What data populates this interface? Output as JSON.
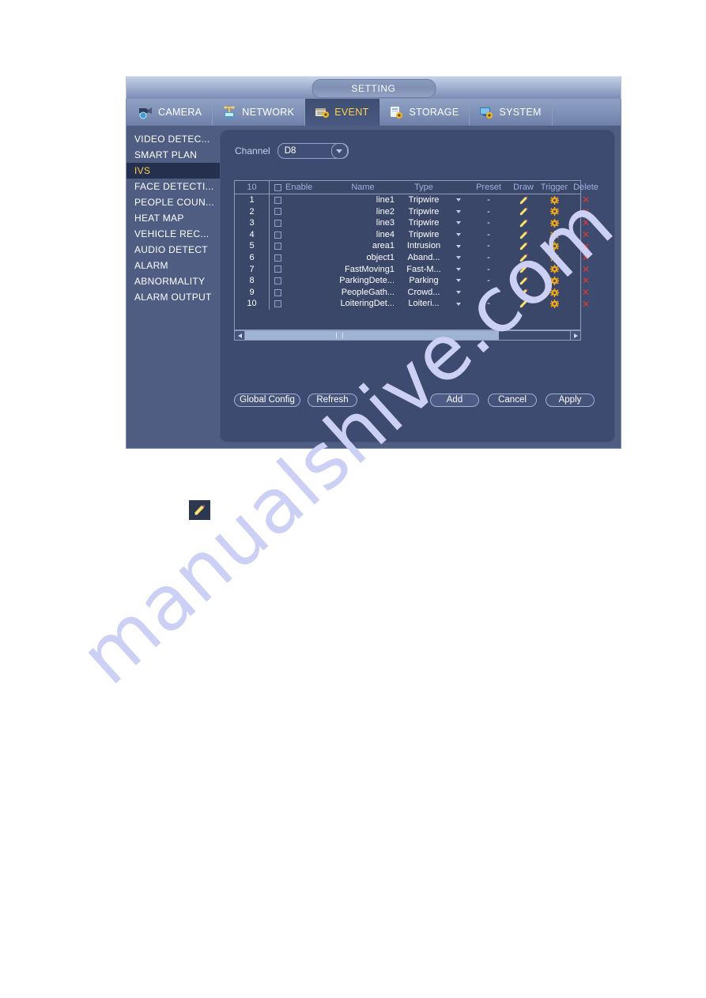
{
  "window": {
    "title": "SETTING",
    "tabs": [
      {
        "label": "CAMERA",
        "icon": "camera-icon",
        "active": false
      },
      {
        "label": "NETWORK",
        "icon": "network-icon",
        "active": false
      },
      {
        "label": "EVENT",
        "icon": "event-icon",
        "active": true
      },
      {
        "label": "STORAGE",
        "icon": "storage-icon",
        "active": false
      },
      {
        "label": "SYSTEM",
        "icon": "system-icon",
        "active": false
      }
    ]
  },
  "sidebar": {
    "items": [
      {
        "label": "VIDEO DETEC...",
        "active": false
      },
      {
        "label": "SMART PLAN",
        "active": false
      },
      {
        "label": "IVS",
        "active": true
      },
      {
        "label": "FACE DETECTI...",
        "active": false
      },
      {
        "label": "PEOPLE COUN...",
        "active": false
      },
      {
        "label": "HEAT MAP",
        "active": false
      },
      {
        "label": "VEHICLE REC...",
        "active": false
      },
      {
        "label": "AUDIO DETECT",
        "active": false
      },
      {
        "label": "ALARM",
        "active": false
      },
      {
        "label": "ABNORMALITY",
        "active": false
      },
      {
        "label": "ALARM OUTPUT",
        "active": false
      }
    ]
  },
  "channel": {
    "label": "Channel",
    "value": "D8",
    "options": [
      "D8"
    ]
  },
  "table": {
    "headers": {
      "count": "10",
      "enable": "Enable",
      "name": "Name",
      "type": "Type",
      "preset": "Preset",
      "draw": "Draw",
      "trigger": "Trigger",
      "delete": "Delete"
    },
    "rows": [
      {
        "index": "1",
        "enabled": false,
        "name": "line1",
        "type": "Tripwire",
        "preset": "-"
      },
      {
        "index": "2",
        "enabled": false,
        "name": "line2",
        "type": "Tripwire",
        "preset": "-"
      },
      {
        "index": "3",
        "enabled": false,
        "name": "line3",
        "type": "Tripwire",
        "preset": "-"
      },
      {
        "index": "4",
        "enabled": false,
        "name": "line4",
        "type": "Tripwire",
        "preset": "-"
      },
      {
        "index": "5",
        "enabled": false,
        "name": "area1",
        "type": "Intrusion",
        "preset": "-"
      },
      {
        "index": "6",
        "enabled": false,
        "name": "object1",
        "type": "Aband...",
        "preset": "-"
      },
      {
        "index": "7",
        "enabled": false,
        "name": "FastMoving1",
        "type": "Fast-M...",
        "preset": "-"
      },
      {
        "index": "8",
        "enabled": false,
        "name": "ParkingDete...",
        "type": "Parking",
        "preset": "-"
      },
      {
        "index": "9",
        "enabled": false,
        "name": "PeopleGath...",
        "type": "Crowd...",
        "preset": "-"
      },
      {
        "index": "10",
        "enabled": false,
        "name": "LoiteringDet...",
        "type": "Loiteri...",
        "preset": "-"
      }
    ]
  },
  "buttons": {
    "global_config": "Global Config",
    "refresh": "Refresh",
    "add": "Add",
    "cancel": "Cancel",
    "apply": "Apply"
  },
  "watermark": {
    "text": "manualshive.com"
  },
  "icons": {
    "draw": "pencil-icon",
    "trigger": "gear-icon",
    "delete": "close-x-icon",
    "scroll_left": "triangle-left-icon",
    "scroll_right": "triangle-right-icon",
    "dropdown": "chevron-down-icon"
  },
  "colors": {
    "window_bg": "#4f5d82",
    "panel_bg": "#3d4b70",
    "accent_yellow": "#ffd24d",
    "delete_red": "#e03a2f",
    "header_text": "#9fb0de",
    "watermark": "#cdd0f5"
  }
}
